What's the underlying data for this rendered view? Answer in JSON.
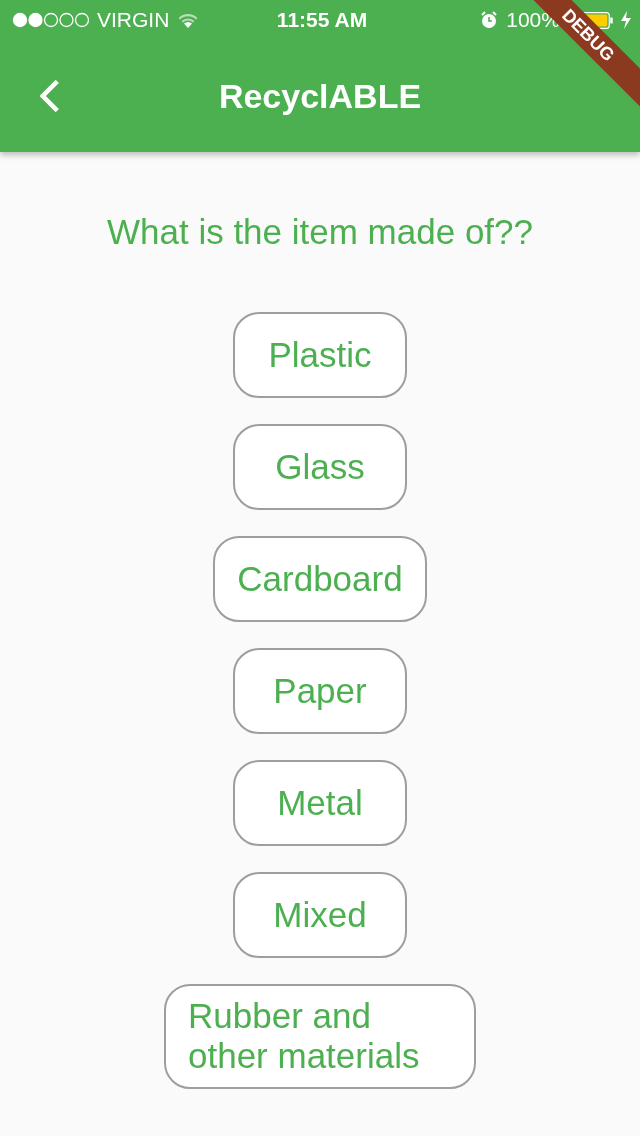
{
  "status_bar": {
    "carrier": "VIRGIN",
    "time": "11:55 AM",
    "battery": "100%"
  },
  "app_bar": {
    "title": "RecyclABLE"
  },
  "debug_banner": "DEBUG",
  "question": "What is the item made of??",
  "options": [
    {
      "label": "Plastic"
    },
    {
      "label": "Glass"
    },
    {
      "label": "Cardboard"
    },
    {
      "label": "Paper"
    },
    {
      "label": "Metal"
    },
    {
      "label": "Mixed"
    },
    {
      "label": "Rubber and other materials"
    }
  ]
}
